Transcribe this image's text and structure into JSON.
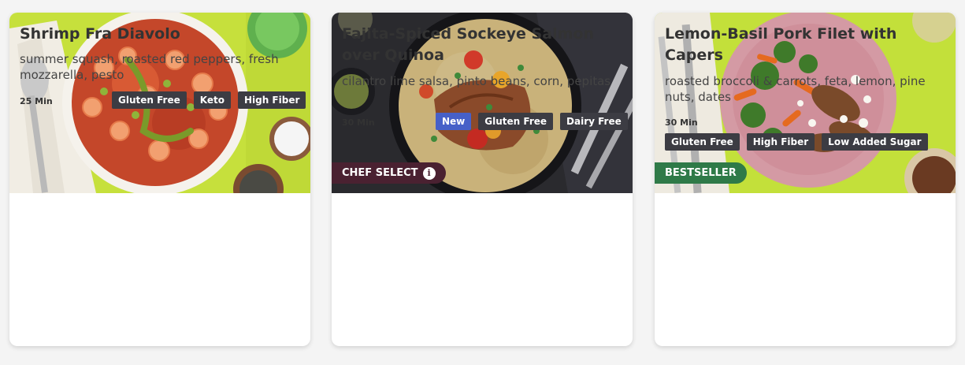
{
  "cards": [
    {
      "title": "Shrimp Fra Diavolo",
      "description": "summer squash, roasted red peppers, fresh mozzarella, pesto",
      "time": "25 Min",
      "badge": "",
      "tags": [
        "Gluten Free",
        "Keto",
        "High Fiber"
      ]
    },
    {
      "title": "Fajita-Spiced Sockeye Salmon over Quinoa",
      "description": "cilantro lime salsa, pinto beans, corn, pepitas",
      "time": "30 Min",
      "badge": "CHEF SELECT",
      "tags": [
        "New",
        "Gluten Free",
        "Dairy Free"
      ]
    },
    {
      "title": "Lemon-Basil Pork Filet with Capers",
      "description": "roasted broccoli & carrots, feta, lemon, pine nuts, dates",
      "time": "30 Min",
      "badge": "BESTSELLER",
      "tags": [
        "Gluten Free",
        "High Fiber",
        "Low Added Sugar"
      ]
    }
  ],
  "colors": {
    "chef_select_badge": "#4a2131",
    "bestseller_badge": "#2f7a48",
    "new_tag": "#4660c8",
    "tag": "#3c3c43",
    "lime_background": "#c3e03a",
    "dark_background": "#2a2a2e"
  },
  "icons": {
    "chef_select_info": "info-icon"
  }
}
